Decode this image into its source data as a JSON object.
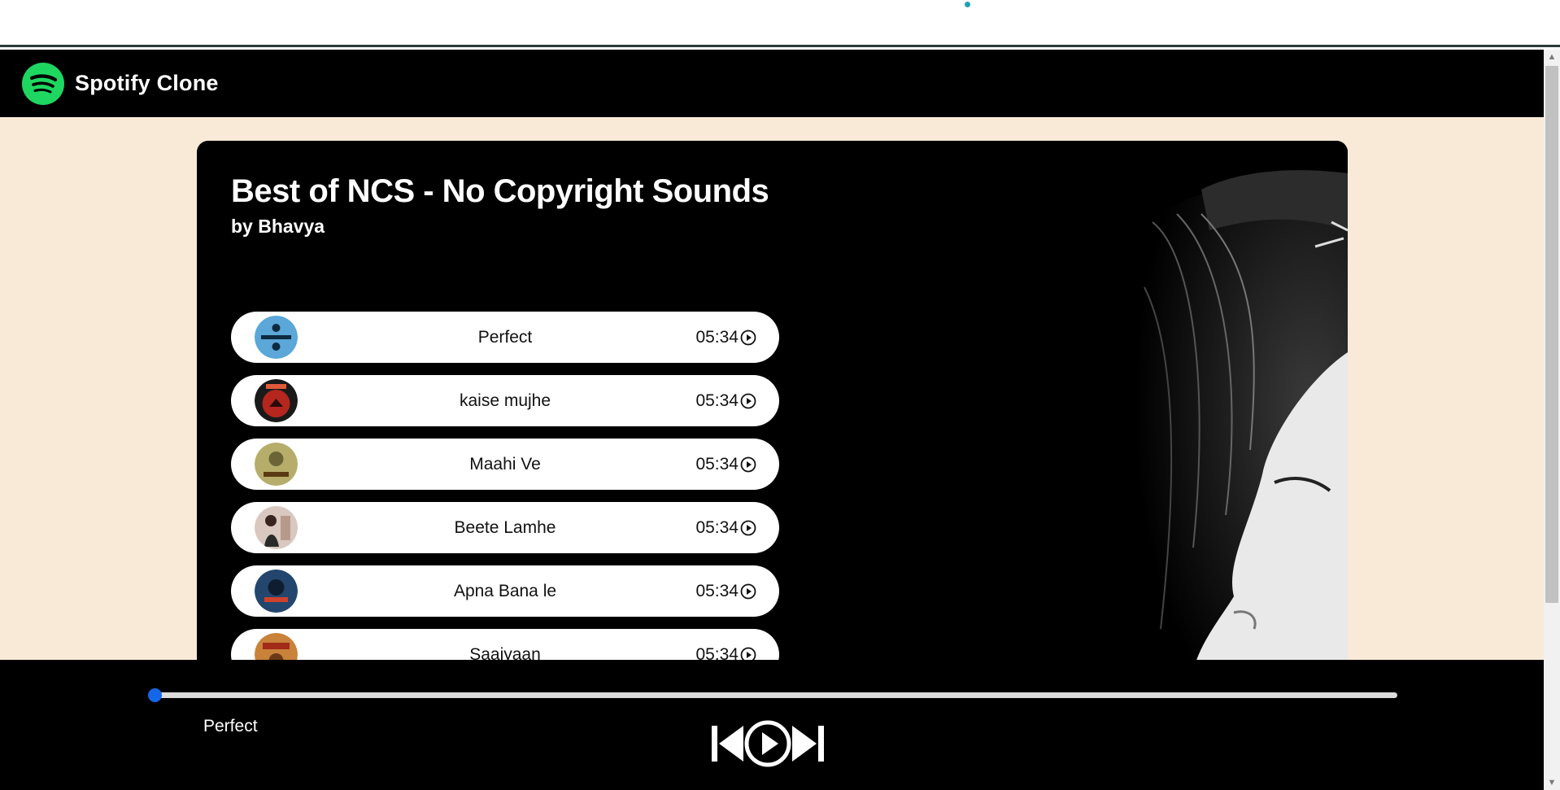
{
  "app": {
    "title": "Spotify Clone"
  },
  "playlist": {
    "title": "Best of NCS - No Copyright Sounds",
    "author": "by Bhavya"
  },
  "songs": [
    {
      "name": "Perfect",
      "duration": "05:34",
      "thumb_color": "#5aa7d8"
    },
    {
      "name": "kaise mujhe",
      "duration": "05:34",
      "thumb_color": "#b5261e"
    },
    {
      "name": "Maahi Ve",
      "duration": "05:34",
      "thumb_color": "#b7ad6b"
    },
    {
      "name": "Beete Lamhe",
      "duration": "05:34",
      "thumb_color": "#d8c8c0"
    },
    {
      "name": "Apna Bana le",
      "duration": "05:34",
      "thumb_color": "#23466e"
    },
    {
      "name": "Saaiyaan",
      "duration": "05:34",
      "thumb_color": "#c9823a"
    }
  ],
  "player": {
    "now_playing": "Perfect",
    "progress": 0,
    "icons": [
      "previous-icon",
      "play-icon",
      "next-icon"
    ]
  },
  "colors": {
    "navbar": "#000000",
    "page_background": "#f8ead7",
    "brand_green": "#1ed760",
    "progress_thumb": "#1467e8"
  }
}
